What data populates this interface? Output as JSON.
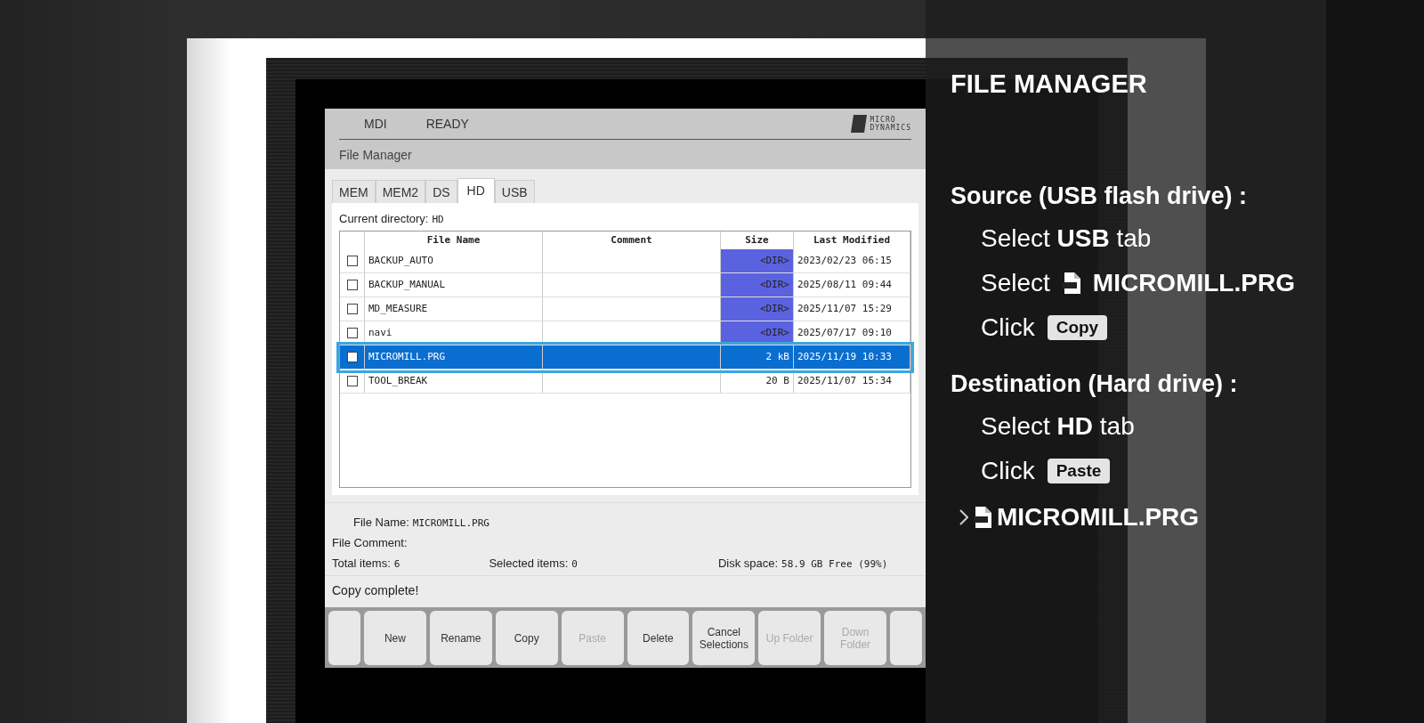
{
  "status_bar": {
    "mode": "MDI",
    "state": "READY",
    "logo": [
      "MICRO",
      "DYNAMICS"
    ]
  },
  "title": "File Manager",
  "tabs": [
    {
      "label": "MEM",
      "selected": false
    },
    {
      "label": "MEM2",
      "selected": false
    },
    {
      "label": "DS",
      "selected": false
    },
    {
      "label": "HD",
      "selected": true
    },
    {
      "label": "USB",
      "selected": false
    }
  ],
  "current_directory": {
    "label": "Current directory:",
    "value": "HD"
  },
  "table": {
    "columns": [
      "File Name",
      "Comment",
      "Size",
      "Last Modified"
    ],
    "rows": [
      {
        "checked": false,
        "selected": false,
        "kind": "dir",
        "name": "BACKUP_AUTO",
        "comment": "",
        "size": "<DIR>",
        "modified": "2023/02/23 06:15"
      },
      {
        "checked": false,
        "selected": false,
        "kind": "dir",
        "name": "BACKUP_MANUAL",
        "size": "<DIR>",
        "modified": "2025/08/11 09:44"
      },
      {
        "checked": false,
        "selected": false,
        "kind": "dir",
        "name": "MD_MEASURE",
        "size": "<DIR>",
        "modified": "2025/11/07 15:29"
      },
      {
        "checked": false,
        "selected": false,
        "kind": "dir",
        "name": "navi",
        "size": "<DIR>",
        "modified": "2025/07/17 09:10"
      },
      {
        "checked": false,
        "selected": true,
        "kind": "file",
        "name": "MICROMILL.PRG",
        "size": "2 kB",
        "modified": "2025/11/19 10:33"
      },
      {
        "checked": false,
        "selected": false,
        "kind": "file",
        "name": "TOOL_BREAK",
        "size": "20 B",
        "modified": "2025/11/07 15:34"
      }
    ]
  },
  "details": {
    "file_name_label": "File Name:",
    "file_name": "MICROMILL.PRG",
    "comment_label": "File Comment:",
    "total_label": "Total items:",
    "total": "6",
    "selected_label": "Selected items:",
    "selected": "0",
    "disk_label": "Disk space:",
    "disk": "58.9 GB Free (99%)"
  },
  "message": "Copy complete!",
  "buttons": [
    {
      "kind": "blank"
    },
    {
      "kind": "label",
      "label": "New",
      "disabled": false
    },
    {
      "kind": "label",
      "label": "Rename",
      "disabled": false
    },
    {
      "kind": "label",
      "label": "Copy",
      "disabled": false
    },
    {
      "kind": "label",
      "label": "Paste",
      "disabled": true
    },
    {
      "kind": "label",
      "label": "Delete",
      "disabled": false
    },
    {
      "kind": "label",
      "label": "Cancel Selections",
      "disabled": false
    },
    {
      "kind": "label",
      "label": "Up Folder",
      "disabled": true
    },
    {
      "kind": "label",
      "label": "Down Folder",
      "disabled": true
    },
    {
      "kind": "blank"
    }
  ],
  "overlay": {
    "title": "FILE MANAGER",
    "sections": [
      {
        "heading": "Source (USB flash drive) :",
        "steps": [
          {
            "kind": "text",
            "text": "Select **USB** tab"
          },
          {
            "kind": "file",
            "verb": "Select",
            "target": "MICROMILL.PRG"
          },
          {
            "kind": "button",
            "verb": "Click",
            "target": "Copy"
          }
        ]
      },
      {
        "heading": "Destination (Hard drive) :",
        "steps": [
          {
            "kind": "text",
            "text": "Select **HD** tab"
          },
          {
            "kind": "button",
            "verb": "Click",
            "target": "Paste"
          }
        ]
      }
    ],
    "result": "MICROMILL.PRG"
  }
}
